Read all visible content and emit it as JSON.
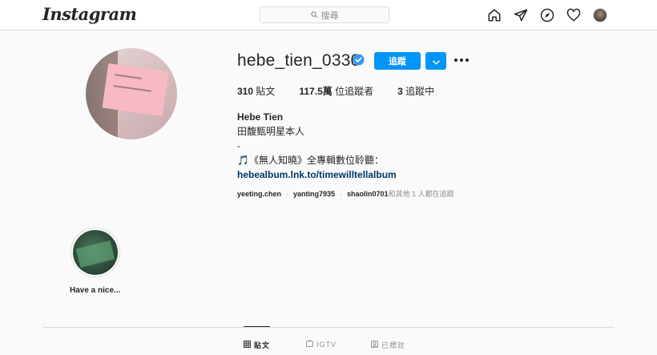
{
  "nav": {
    "logo": "Instagram",
    "search_placeholder": "搜尋",
    "icons": [
      "home-icon",
      "direct-icon",
      "explore-icon",
      "heart-icon",
      "profile-avatar"
    ]
  },
  "profile": {
    "username": "hebe_tien_0330",
    "verified": true,
    "follow_label": "追蹤",
    "stats": {
      "posts_count": "310",
      "posts_label": " 貼文",
      "followers_count": "117.5萬",
      "followers_label": " 位追蹤者",
      "following_count": "3",
      "following_label": " 追蹤中"
    },
    "bio": {
      "name": "Hebe Tien",
      "line1": "田馥甄明星本人",
      "line2": "-",
      "line3": "🎵《無人知曉》全專輯數位聆聽：",
      "link": "hebealbum.lnk.to/timewilltellalbum"
    },
    "followed_by": {
      "users": [
        "yeeting.chen",
        "yanting7935",
        "shaolin0701"
      ],
      "suffix": " 和其他 1 人都在追蹤"
    }
  },
  "highlights": [
    {
      "label": "Have a nice..."
    }
  ],
  "tabs": [
    {
      "label": "貼文",
      "icon": "grid-icon",
      "active": true
    },
    {
      "label": "IGTV",
      "icon": "igtv-icon",
      "active": false
    },
    {
      "label": "已標註",
      "icon": "tagged-icon",
      "active": false
    }
  ],
  "colors": {
    "accent": "#0095f6",
    "link": "#00376b",
    "border": "#dbdbdb",
    "background": "#fafafa"
  }
}
